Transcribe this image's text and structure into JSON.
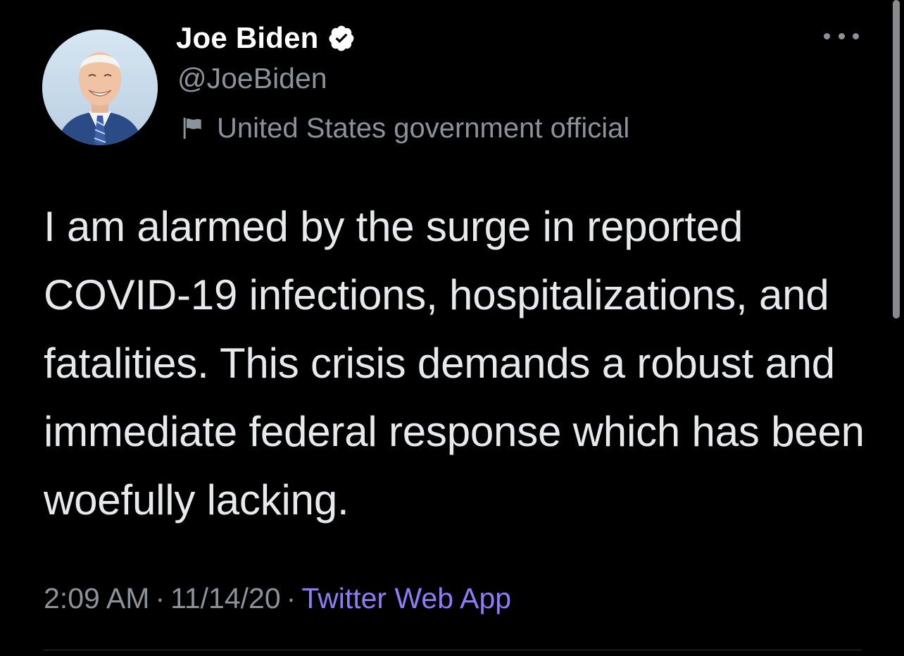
{
  "author": {
    "display_name": "Joe Biden",
    "handle": "@JoeBiden",
    "verified": true,
    "label": "United States government official"
  },
  "tweet": {
    "text": "I am alarmed by the surge in reported COVID-19 infections, hospitalizations, and fatalities. This crisis demands a robust and immediate federal response which has been woefully lacking.",
    "time": "2:09 AM",
    "date": "11/14/20",
    "separator": "·",
    "source": "Twitter Web App"
  },
  "icons": {
    "verified": "verified-badge-icon",
    "label": "flag-icon",
    "more": "more-horizontal-icon"
  },
  "colors": {
    "background": "#000000",
    "text": "#e7e9ea",
    "secondary_text": "#8b9299",
    "source_link": "#8f7cf6"
  }
}
